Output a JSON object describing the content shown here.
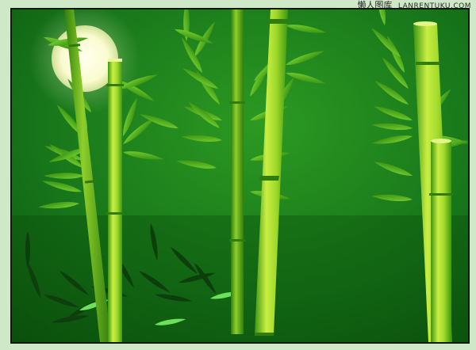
{
  "watermark": {
    "chinese": "懒人图库",
    "latin": "LANRENTUKU.COM"
  },
  "colors": {
    "frame": "#cfe8c8",
    "bg_dark": "#0b5a0b",
    "bg_mid": "#21891c",
    "moon": "#fbfde0",
    "stalk_light": "#c6ec3a",
    "stalk_dark": "#3f9a10",
    "leaf": "#59c11e"
  },
  "icons": [
    "moon-shape",
    "bamboo-stalk",
    "bamboo-leaf"
  ]
}
